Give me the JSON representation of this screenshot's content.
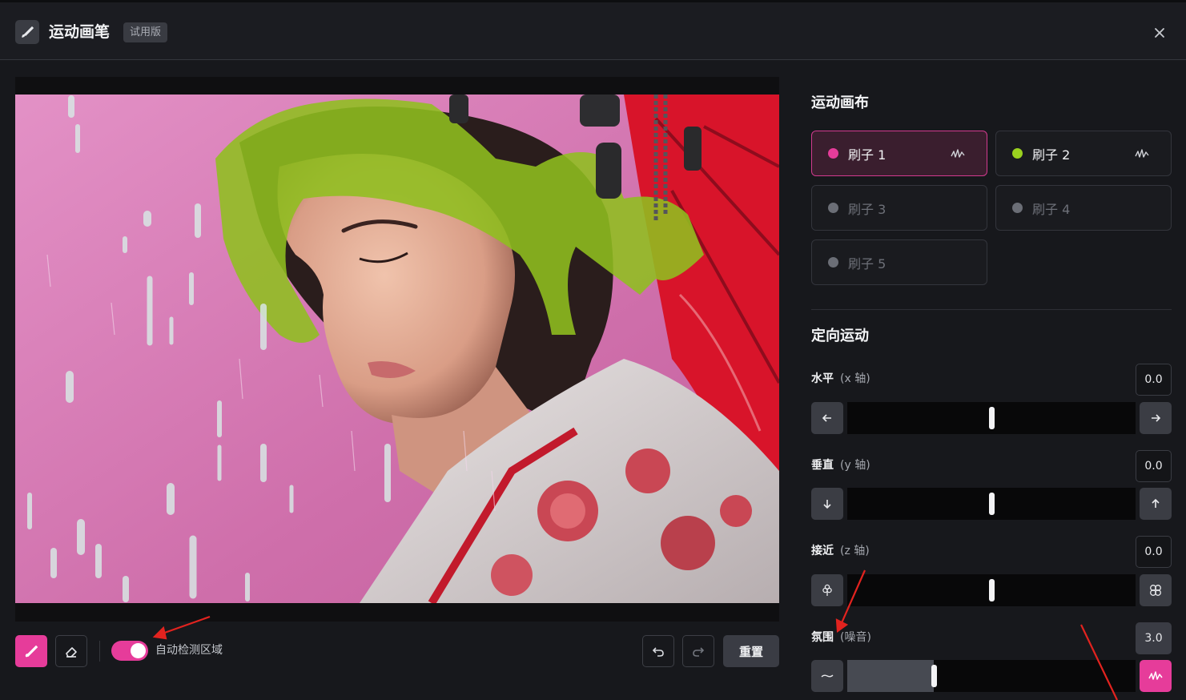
{
  "header": {
    "title": "运动画笔",
    "badge": "试用版"
  },
  "canvas": {
    "auto_detect_label": "自动检测区域",
    "auto_detect_on": true,
    "reset_label": "重置"
  },
  "motion_canvas": {
    "title": "运动画布",
    "brushes": [
      {
        "label": "刷子 1",
        "color": "#e63c9a",
        "active": true,
        "enabled": true
      },
      {
        "label": "刷子 2",
        "color": "#9ad11f",
        "active": false,
        "enabled": true
      },
      {
        "label": "刷子 3",
        "color": "#6b6e76",
        "active": false,
        "enabled": false
      },
      {
        "label": "刷子 4",
        "color": "#6b6e76",
        "active": false,
        "enabled": false
      },
      {
        "label": "刷子 5",
        "color": "#6b6e76",
        "active": false,
        "enabled": false
      }
    ]
  },
  "directional": {
    "title": "定向运动",
    "horizontal": {
      "label": "水平",
      "sub": "(x 轴)",
      "value": "0.0",
      "level": 0.5
    },
    "vertical": {
      "label": "垂直",
      "sub": "(y 轴)",
      "value": "0.0",
      "level": 0.5
    },
    "approach": {
      "label": "接近",
      "sub": "(z 轴)",
      "value": "0.0",
      "level": 0.5
    },
    "ambience": {
      "label": "氛围",
      "sub": "(噪音)",
      "value": "3.0",
      "level": 0.3
    }
  },
  "colors": {
    "accent": "#e63c9a",
    "brush2": "#9ad11f",
    "background": "#17181c"
  },
  "icons": [
    "brush-icon",
    "close-icon",
    "eraser-icon",
    "undo-icon",
    "redo-icon",
    "wave-icon",
    "arrow-left-icon",
    "arrow-right-icon",
    "arrow-down-icon",
    "arrow-up-icon",
    "flower-closed-icon",
    "flower-open-icon",
    "calm-wave-icon",
    "noise-wave-icon"
  ]
}
